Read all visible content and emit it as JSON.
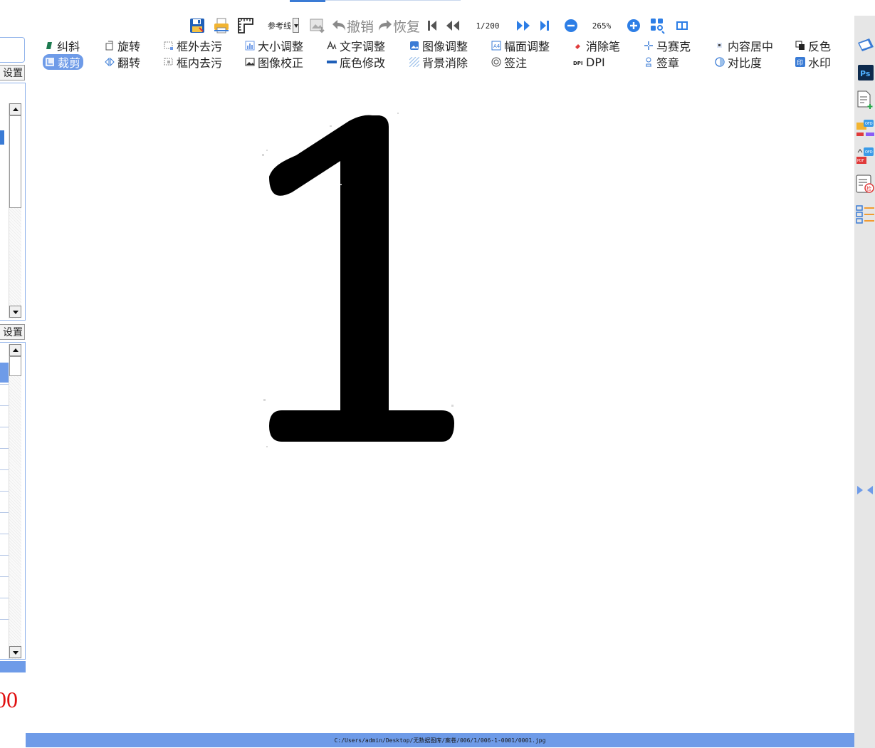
{
  "toolbar": {
    "ref_line_label": "参考线",
    "undo_label": "撤销",
    "redo_label": "恢复",
    "page_indicator": "1/200",
    "zoom_level": "265%"
  },
  "tools": {
    "row1": [
      "纠斜",
      "旋转",
      "框外去污",
      "大小调整",
      "文字调整",
      "图像调整",
      "幅面调整",
      "消除笔",
      "马赛克",
      "内容居中",
      "反色"
    ],
    "row2": [
      "裁剪",
      "翻转",
      "框内去污",
      "图像校正",
      "底色修改",
      "背景消除",
      "签注",
      "DPI",
      "签章",
      "对比度",
      "水印"
    ],
    "active": "裁剪"
  },
  "left_panel": {
    "settings_label_1": "设置",
    "settings_label_2": "设置",
    "count_text": "00"
  },
  "document": {
    "glyph": "1"
  },
  "status": {
    "file_path": "C:/Users/admin/Desktop/无数据图库/案卷/006/1/006-1-0001/0001.jpg"
  },
  "colors": {
    "accent": "#6e9be8",
    "toolbar_blue": "#3a7bd5",
    "count_red": "#e01010"
  },
  "icons": {
    "toolbar": [
      "save-icon",
      "print-icon",
      "ruler-icon",
      "image-export-icon",
      "undo-icon",
      "redo-icon",
      "first-page-icon",
      "prev-page-icon",
      "next-page-icon",
      "last-page-icon",
      "zoom-out-icon",
      "zoom-in-icon",
      "layout-icon",
      "split-view-icon"
    ],
    "sidebar": [
      "scan-icon",
      "photoshop-icon",
      "add-document-icon",
      "ofd-convert-icon",
      "pdf-ofd-convert-icon",
      "check-icon",
      "list-icon",
      "collapse-icon"
    ]
  }
}
